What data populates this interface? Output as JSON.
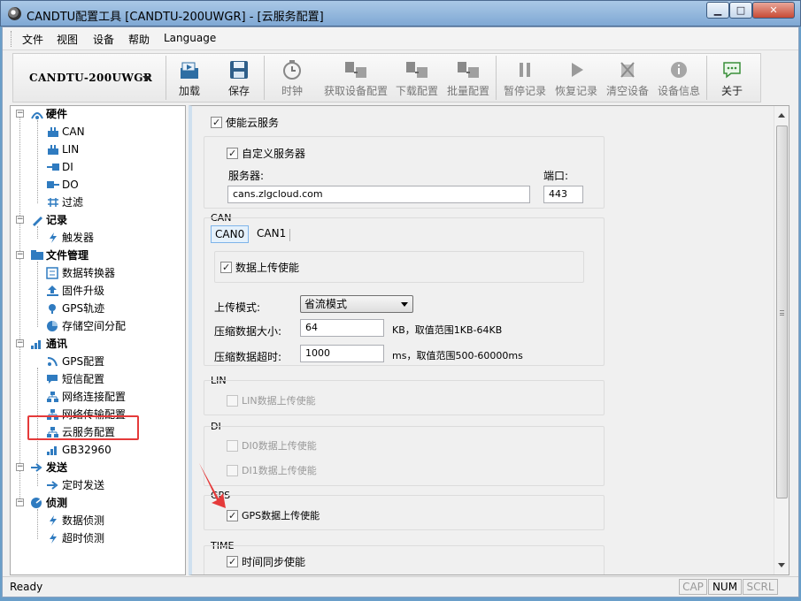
{
  "window": {
    "title": "CANDTU配置工具 [CANDTU-200UWGR] - [云服务配置]",
    "min_btn": "▁",
    "max_btn": "□",
    "close_btn": "✕"
  },
  "menu": [
    "文件",
    "视图",
    "设备",
    "帮助",
    "Language"
  ],
  "toolbar": {
    "device": "CANDTU-200UWGR",
    "buttons": [
      {
        "label": "加载",
        "icon": "load-icon",
        "enabled": true
      },
      {
        "label": "保存",
        "icon": "save-icon",
        "enabled": true
      },
      {
        "label": "时钟",
        "icon": "clock-icon",
        "enabled": false
      },
      {
        "label": "获取设备配置",
        "icon": "get-config-icon",
        "enabled": false
      },
      {
        "label": "下载配置",
        "icon": "download-config-icon",
        "enabled": false
      },
      {
        "label": "批量配置",
        "icon": "batch-config-icon",
        "enabled": false
      },
      {
        "label": "暂停记录",
        "icon": "pause-icon",
        "enabled": false
      },
      {
        "label": "恢复记录",
        "icon": "play-icon",
        "enabled": false
      },
      {
        "label": "清空设备",
        "icon": "clear-device-icon",
        "enabled": false
      },
      {
        "label": "设备信息",
        "icon": "info-icon",
        "enabled": false
      },
      {
        "label": "关于",
        "icon": "about-icon",
        "enabled": true
      }
    ]
  },
  "tree": {
    "groups": [
      {
        "label": "硬件",
        "children": [
          "CAN",
          "LIN",
          "DI",
          "DO",
          "过滤"
        ]
      },
      {
        "label": "记录",
        "children": [
          "触发器"
        ]
      },
      {
        "label": "文件管理",
        "children": [
          "数据转换器",
          "固件升级",
          "GPS轨迹",
          "存储空间分配"
        ]
      },
      {
        "label": "通讯",
        "children": [
          "GPS配置",
          "短信配置",
          "网络连接配置",
          "网络传输配置",
          "云服务配置",
          "GB32960"
        ]
      },
      {
        "label": "发送",
        "children": [
          "定时发送"
        ]
      },
      {
        "label": "侦测",
        "children": [
          "数据侦测",
          "超时侦测"
        ]
      }
    ],
    "selected": "云服务配置"
  },
  "cloud": {
    "enable_cloud": "使能云服务",
    "custom_server": "自定义服务器",
    "server_label": "服务器:",
    "port_label": "端口:",
    "server_value": "cans.zlgcloud.com",
    "port_value": "443",
    "can": {
      "title": "CAN",
      "tabs": [
        "CAN0",
        "CAN1"
      ],
      "upload_enable": "数据上传使能",
      "upload_mode_label": "上传模式:",
      "upload_mode_value": "省流模式",
      "compress_size_label": "压缩数据大小:",
      "compress_size_value": "64",
      "compress_size_hint": "KB，取值范围1KB-64KB",
      "compress_timeout_label": "压缩数据超时:",
      "compress_timeout_value": "1000",
      "compress_timeout_hint": "ms，取值范围500-60000ms"
    },
    "lin": {
      "title": "LIN",
      "upload_enable": "LIN数据上传使能"
    },
    "di": {
      "title": "DI",
      "di0": "DI0数据上传使能",
      "di1": "DI1数据上传使能"
    },
    "gps": {
      "title": "GPS",
      "upload_enable": "GPS数据上传使能"
    },
    "time": {
      "title": "TIME",
      "sync_enable": "时间同步使能"
    }
  },
  "status": {
    "text": "Ready",
    "indicators": [
      {
        "label": "CAP",
        "on": false
      },
      {
        "label": "NUM",
        "on": true
      },
      {
        "label": "SCRL",
        "on": false
      }
    ]
  },
  "colors": {
    "highlight_box": "#e53a3a",
    "annotation_arrow": "#e53a3a"
  }
}
